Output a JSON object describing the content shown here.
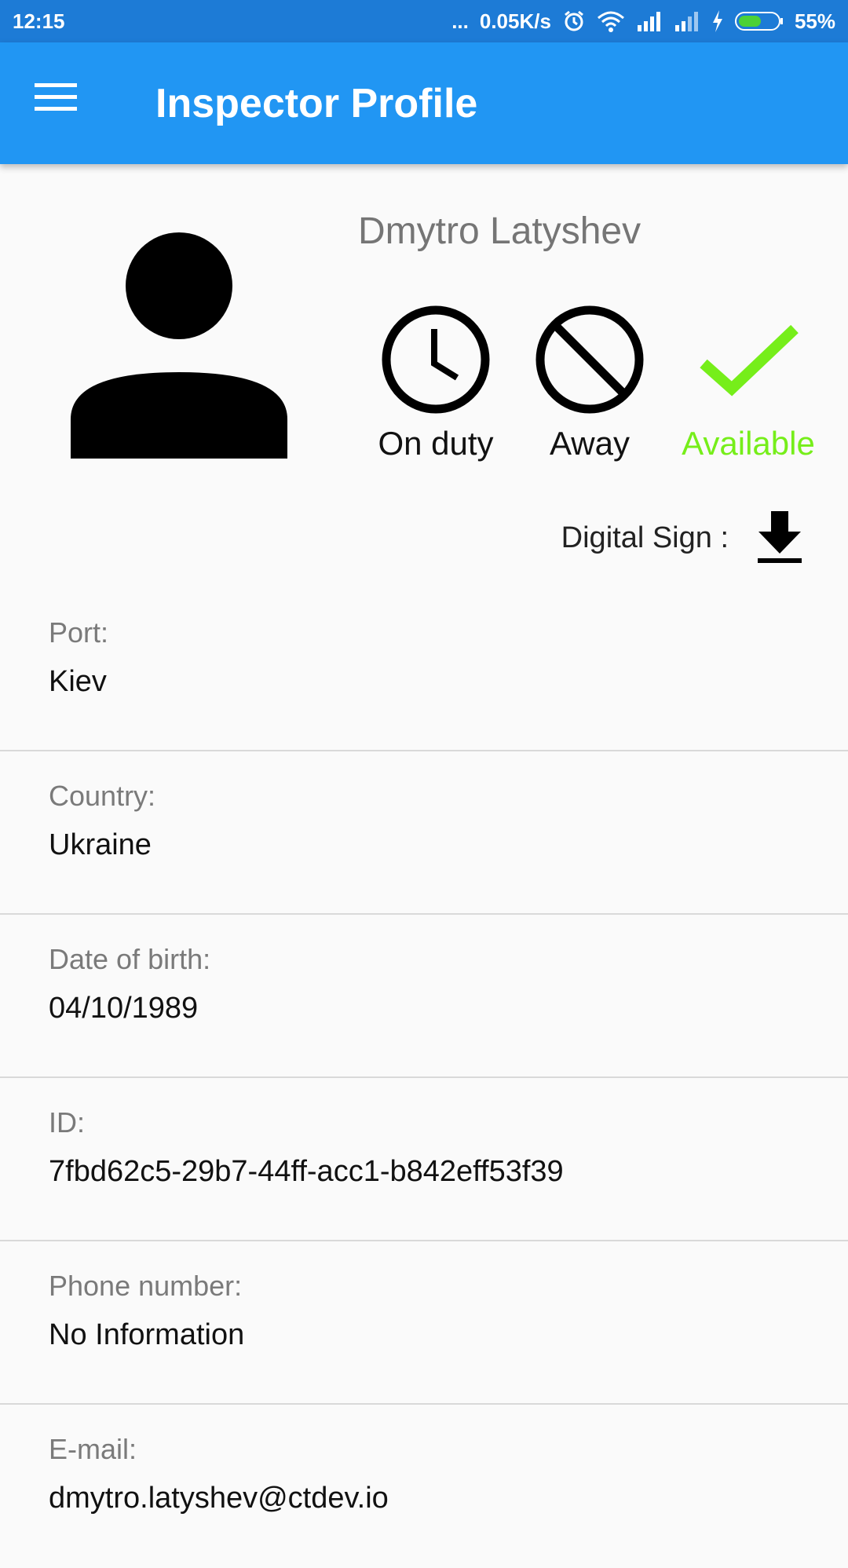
{
  "status_bar": {
    "time": "12:15",
    "dots": "...",
    "speed": "0.05K/s",
    "battery": "55%",
    "icons": [
      "alarm-icon",
      "wifi-icon",
      "signal-icon",
      "signal-icon",
      "charging-icon",
      "battery-icon"
    ]
  },
  "app_bar": {
    "title": "Inspector Profile",
    "menu_icon": "hamburger-menu-icon"
  },
  "profile": {
    "name": "Dmytro Latyshev",
    "statuses": [
      {
        "label": "On duty",
        "icon": "clock-icon"
      },
      {
        "label": "Away",
        "icon": "block-icon"
      },
      {
        "label": "Available",
        "icon": "check-icon",
        "selected": true
      }
    ],
    "digital_sign_label": "Digital Sign :",
    "digital_sign_icon": "download-icon"
  },
  "fields": [
    {
      "label": "Port:",
      "value": "Kiev"
    },
    {
      "label": "Country:",
      "value": "Ukraine"
    },
    {
      "label": "Date of birth:",
      "value": "04/10/1989"
    },
    {
      "label": "ID:",
      "value": "7fbd62c5-29b7-44ff-acc1-b842eff53f39"
    },
    {
      "label": "Phone number:",
      "value": "No Information"
    },
    {
      "label": "E-mail:",
      "value": "dmytro.latyshev@ctdev.io"
    }
  ],
  "colors": {
    "app_bar": "#2196f3",
    "status_bar": "#1d7bd6",
    "available": "#76ee1a",
    "battery_fill": "#4cd137"
  }
}
